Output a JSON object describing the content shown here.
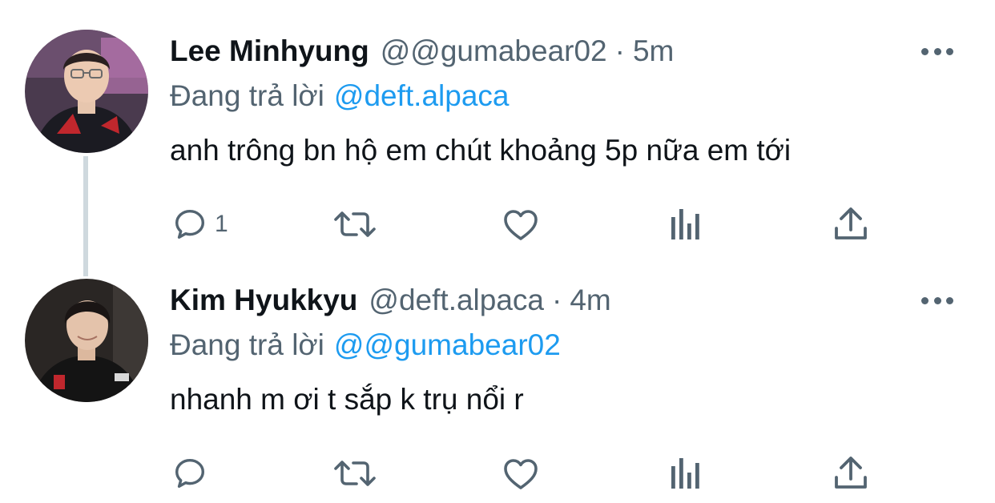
{
  "tweets": [
    {
      "name": "Lee Minhyung",
      "handle": "@@gumabear02",
      "separator": "·",
      "time": "5m",
      "replying_label": "Đang trả lời",
      "replying_to": "@deft.alpaca",
      "text": "anh trông bn hộ em chút khoảng 5p nữa em tới",
      "reply_count": "1",
      "avatar_icon": "user-avatar-photo"
    },
    {
      "name": "Kim Hyukkyu",
      "handle": "@deft.alpaca",
      "separator": "·",
      "time": "4m",
      "replying_label": "Đang trả lời",
      "replying_to": "@@gumabear02",
      "text": "nhanh m ơi t sắp k trụ nổi r",
      "reply_count": "",
      "avatar_icon": "user-avatar-photo"
    }
  ],
  "icons": [
    "reply-icon",
    "retweet-icon",
    "like-icon",
    "views-icon",
    "share-icon",
    "more-icon"
  ],
  "colors": {
    "text": "#0f1419",
    "secondary": "#536471",
    "link": "#1d9bf0",
    "thread_line": "#cfd9de"
  }
}
